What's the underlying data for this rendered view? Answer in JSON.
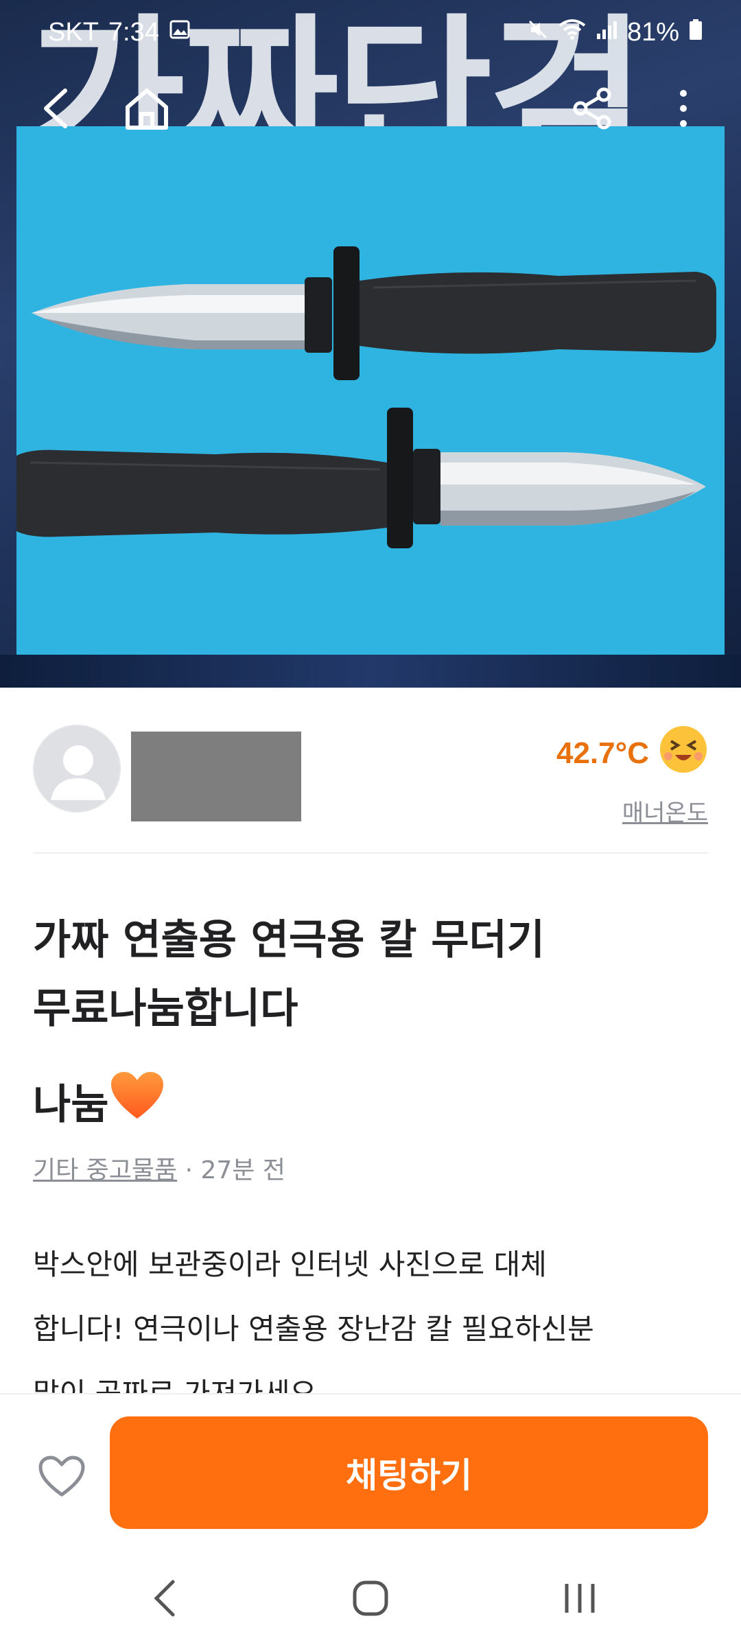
{
  "status_bar": {
    "carrier": "SKT",
    "time": "7:34",
    "battery": "81%"
  },
  "hero": {
    "overlay_text": "가짜단검"
  },
  "icons": {
    "back": "back-arrow-icon",
    "home": "home-icon",
    "share": "share-icon",
    "more": "more-vertical-icon",
    "avatar": "avatar-placeholder-icon",
    "manner_face": "grinning-squint-emoji-icon",
    "like": "heart-outline-icon",
    "price_emoji": "orange-heart-emoji-icon"
  },
  "seller": {
    "temperature": "42.7°C",
    "manner_label": "매너온도"
  },
  "post": {
    "title_line1": "가짜 연출용 연극용 칼 무더기",
    "title_line2": "무료나눔합니다",
    "price": "나눔",
    "category": "기타 중고물품",
    "time_ago": " · 27분 전",
    "desc_line1": "박스안에 보관중이라 인터넷 사진으로 대체",
    "desc_line2": "합니다! 연극이나 연출용 장난감 칼 필요하신분",
    "desc_line3": "많이 공짜로 가져가세요."
  },
  "action": {
    "chat_label": "채팅하기"
  },
  "colors": {
    "accent": "#ff6f0f",
    "temperature": "#e8710c",
    "photo_bg": "#2fb4e2"
  }
}
